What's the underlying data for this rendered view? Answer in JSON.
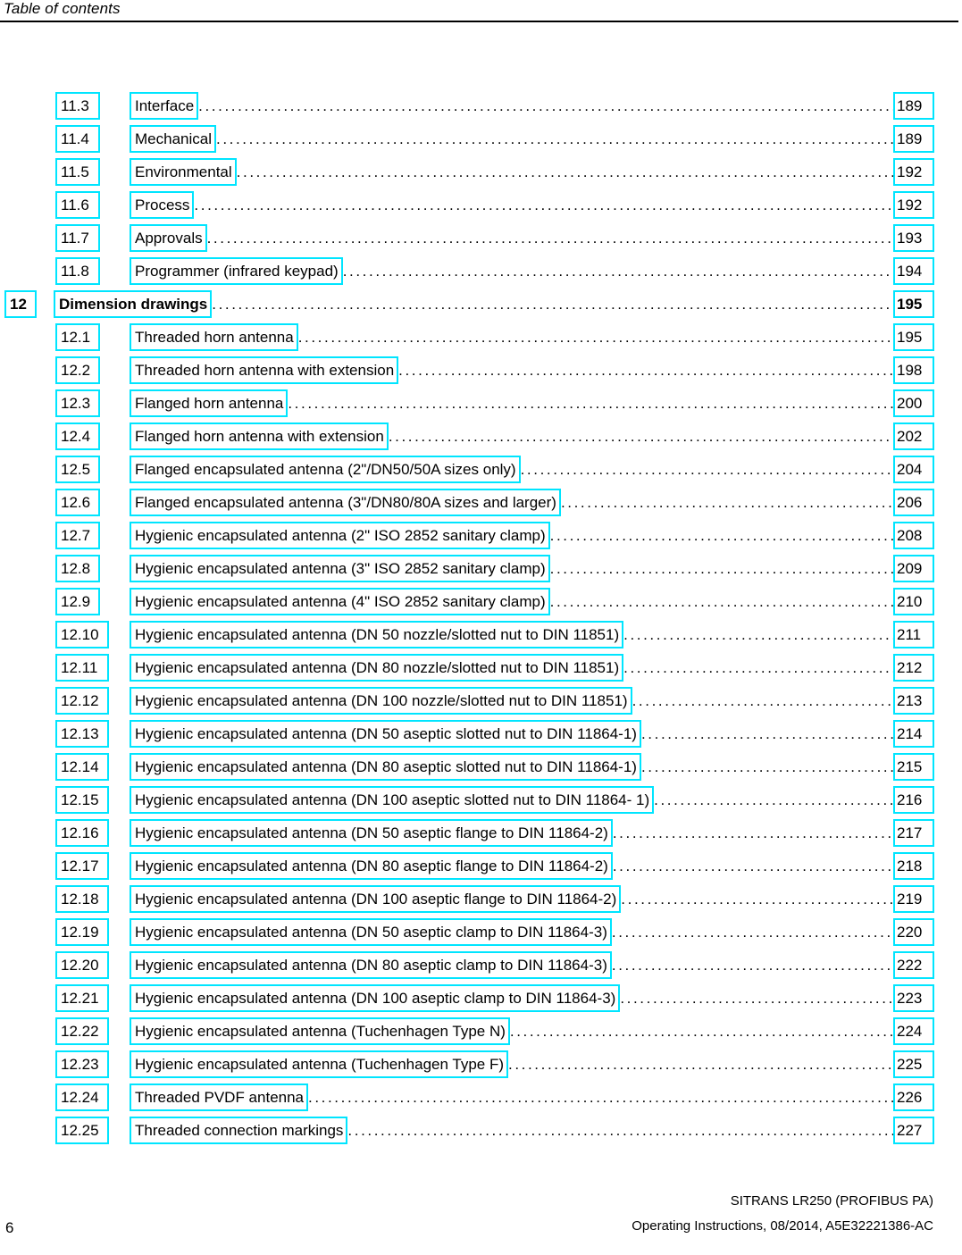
{
  "header": {
    "title": "Table of contents"
  },
  "accent_color": "#00e5ff",
  "leader_dots": "..................................................................................................................................................................",
  "toc": {
    "entries": [
      {
        "level": 2,
        "number": "11.3",
        "title": "Interface",
        "page": "189"
      },
      {
        "level": 2,
        "number": "11.4",
        "title": "Mechanical",
        "page": "189"
      },
      {
        "level": 2,
        "number": "11.5",
        "title": "Environmental",
        "page": "192"
      },
      {
        "level": 2,
        "number": "11.6",
        "title": "Process",
        "page": "192"
      },
      {
        "level": 2,
        "number": "11.7",
        "title": "Approvals",
        "page": "193"
      },
      {
        "level": 2,
        "number": "11.8",
        "title": "Programmer (infrared keypad)",
        "page": "194"
      },
      {
        "level": 1,
        "number": "12",
        "title": "Dimension drawings",
        "page": "195"
      },
      {
        "level": 2,
        "number": "12.1",
        "title": "Threaded horn antenna",
        "page": "195"
      },
      {
        "level": 2,
        "number": "12.2",
        "title": "Threaded horn antenna with extension",
        "page": "198"
      },
      {
        "level": 2,
        "number": "12.3",
        "title": "Flanged horn antenna",
        "page": "200"
      },
      {
        "level": 2,
        "number": "12.4",
        "title": "Flanged horn antenna with extension",
        "page": "202"
      },
      {
        "level": 2,
        "number": "12.5",
        "title": "Flanged encapsulated antenna (2\"/DN50/50A sizes only)",
        "page": "204"
      },
      {
        "level": 2,
        "number": "12.6",
        "title": "Flanged encapsulated antenna (3\"/DN80/80A sizes and larger)",
        "page": "206"
      },
      {
        "level": 2,
        "number": "12.7",
        "title": "Hygienic encapsulated antenna (2\" ISO 2852 sanitary clamp)",
        "page": "208"
      },
      {
        "level": 2,
        "number": "12.8",
        "title": "Hygienic encapsulated antenna (3\" ISO 2852 sanitary clamp)",
        "page": "209"
      },
      {
        "level": 2,
        "number": "12.9",
        "title": "Hygienic encapsulated antenna (4\" ISO 2852 sanitary clamp)",
        "page": "210"
      },
      {
        "level": 2,
        "number": "12.10",
        "title": "Hygienic encapsulated antenna (DN 50 nozzle/slotted nut to DIN 11851)",
        "page": "211"
      },
      {
        "level": 2,
        "number": "12.11",
        "title": "Hygienic encapsulated antenna (DN 80 nozzle/slotted nut to DIN 11851)",
        "page": "212"
      },
      {
        "level": 2,
        "number": "12.12",
        "title": "Hygienic encapsulated antenna (DN 100 nozzle/slotted nut to DIN 11851)",
        "page": "213"
      },
      {
        "level": 2,
        "number": "12.13",
        "title": "Hygienic encapsulated antenna (DN 50 aseptic slotted nut to DIN 11864-1)",
        "page": "214"
      },
      {
        "level": 2,
        "number": "12.14",
        "title": "Hygienic encapsulated antenna (DN 80 aseptic slotted nut to DIN 11864-1)",
        "page": "215"
      },
      {
        "level": 2,
        "number": "12.15",
        "title": "Hygienic encapsulated antenna (DN 100 aseptic slotted nut to DIN 11864- 1)",
        "page": "216"
      },
      {
        "level": 2,
        "number": "12.16",
        "title": "Hygienic encapsulated antenna (DN 50 aseptic flange to DIN 11864-2)",
        "page": "217"
      },
      {
        "level": 2,
        "number": "12.17",
        "title": "Hygienic encapsulated antenna (DN 80 aseptic flange to DIN 11864-2)",
        "page": "218"
      },
      {
        "level": 2,
        "number": "12.18",
        "title": "Hygienic encapsulated antenna (DN 100 aseptic flange to DIN 11864-2)",
        "page": "219"
      },
      {
        "level": 2,
        "number": "12.19",
        "title": "Hygienic encapsulated antenna (DN 50 aseptic clamp to DIN 11864-3)",
        "page": "220"
      },
      {
        "level": 2,
        "number": "12.20",
        "title": "Hygienic encapsulated antenna (DN 80 aseptic clamp to DIN 11864-3)",
        "page": "222"
      },
      {
        "level": 2,
        "number": "12.21",
        "title": "Hygienic encapsulated antenna (DN 100 aseptic clamp to DIN 11864-3)",
        "page": "223"
      },
      {
        "level": 2,
        "number": "12.22",
        "title": "Hygienic encapsulated antenna (Tuchenhagen Type N)",
        "page": "224"
      },
      {
        "level": 2,
        "number": "12.23",
        "title": "Hygienic encapsulated antenna (Tuchenhagen Type F)",
        "page": "225"
      },
      {
        "level": 2,
        "number": "12.24",
        "title": "Threaded PVDF antenna",
        "page": "226"
      },
      {
        "level": 2,
        "number": "12.25",
        "title": "Threaded connection markings",
        "page": "227"
      }
    ]
  },
  "footer": {
    "page_number": "6",
    "line1": "SITRANS LR250 (PROFIBUS PA)",
    "line2": "Operating Instructions, 08/2014, A5E32221386-AC"
  }
}
